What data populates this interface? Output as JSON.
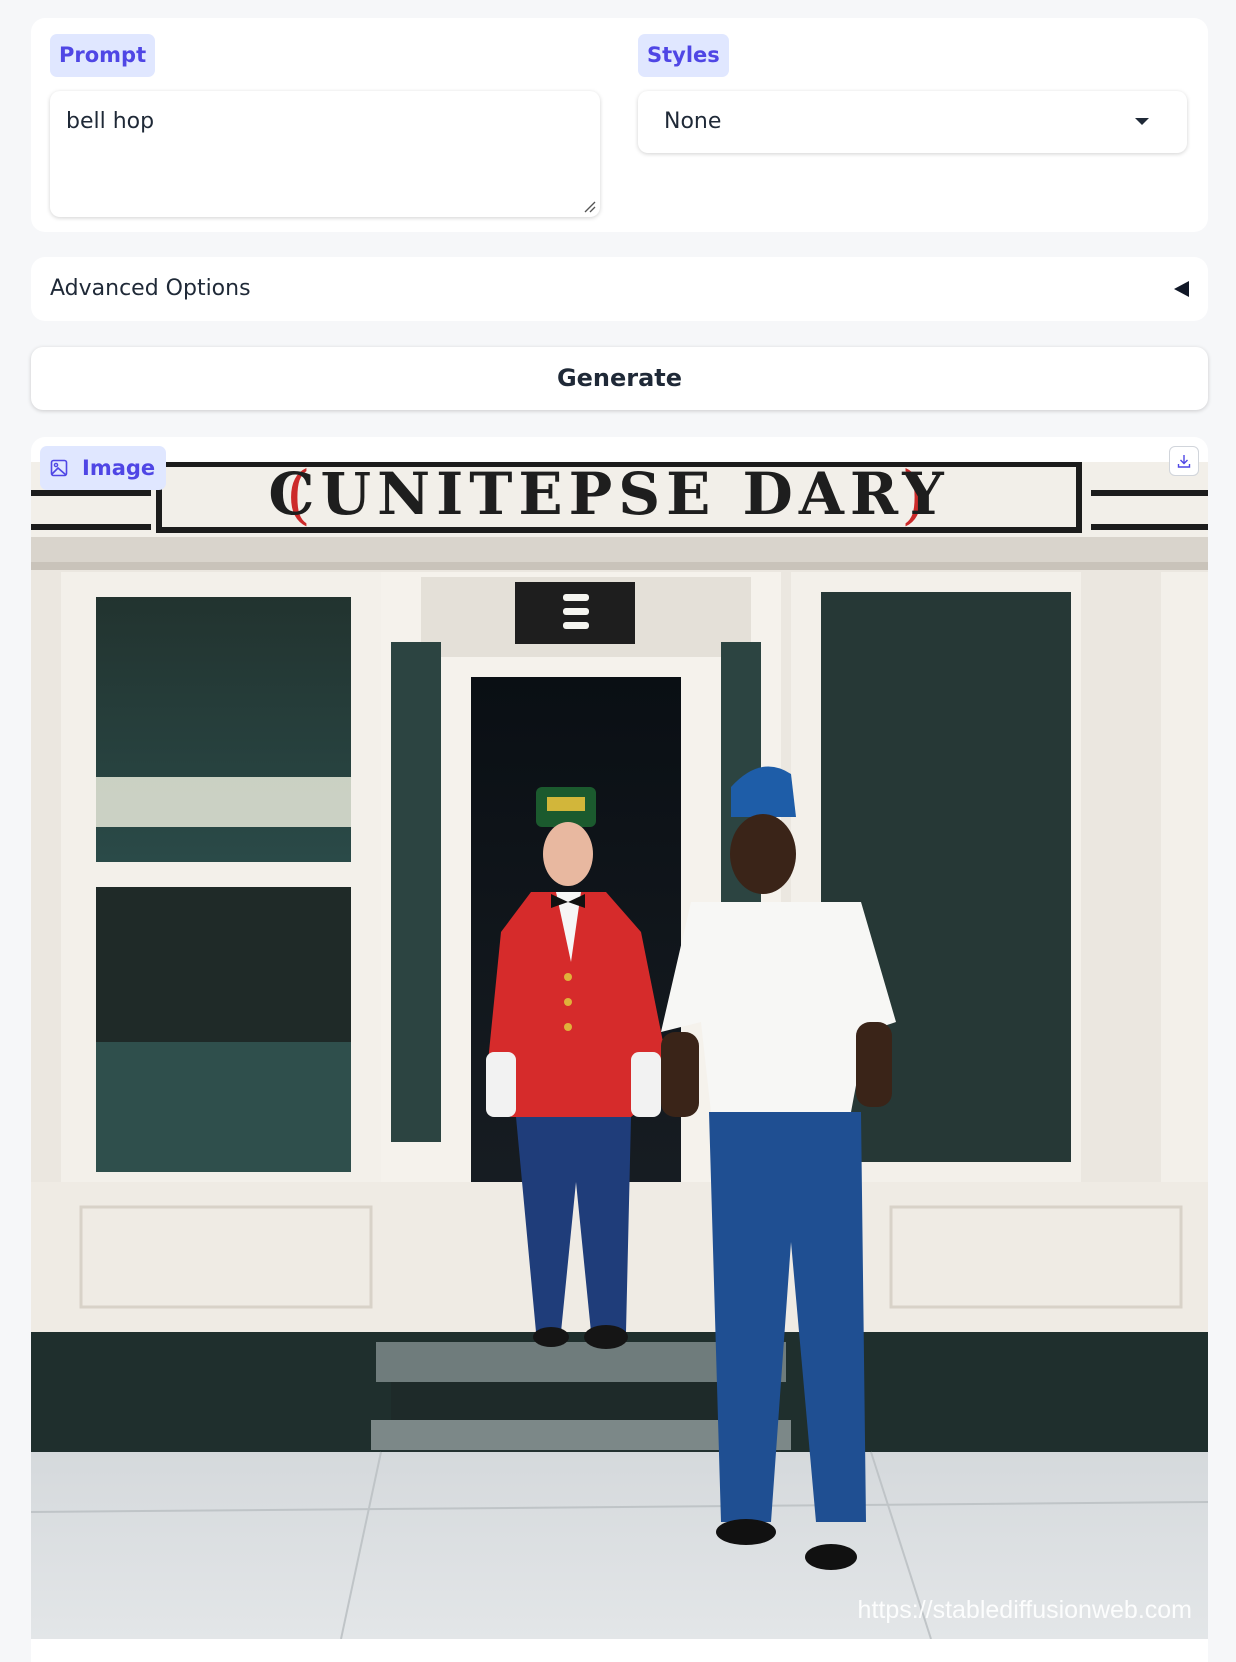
{
  "prompt": {
    "label": "Prompt",
    "value": "bell hop"
  },
  "styles": {
    "label": "Styles",
    "selected": "None"
  },
  "advanced": {
    "label": "Advanced Options"
  },
  "generate": {
    "label": "Generate"
  },
  "output": {
    "label": "Image",
    "sign_text": "CUNITEPSE DARY",
    "watermark": "https://stablediffusionweb.com"
  },
  "icons": [
    "image-icon",
    "download-icon",
    "dropdown-caret-icon",
    "collapse-triangle-icon",
    "resize-handle-icon"
  ],
  "colors": {
    "accent": "#4f46e5",
    "chip_bg": "#e0e7ff",
    "page_bg": "#f6f7f9"
  }
}
